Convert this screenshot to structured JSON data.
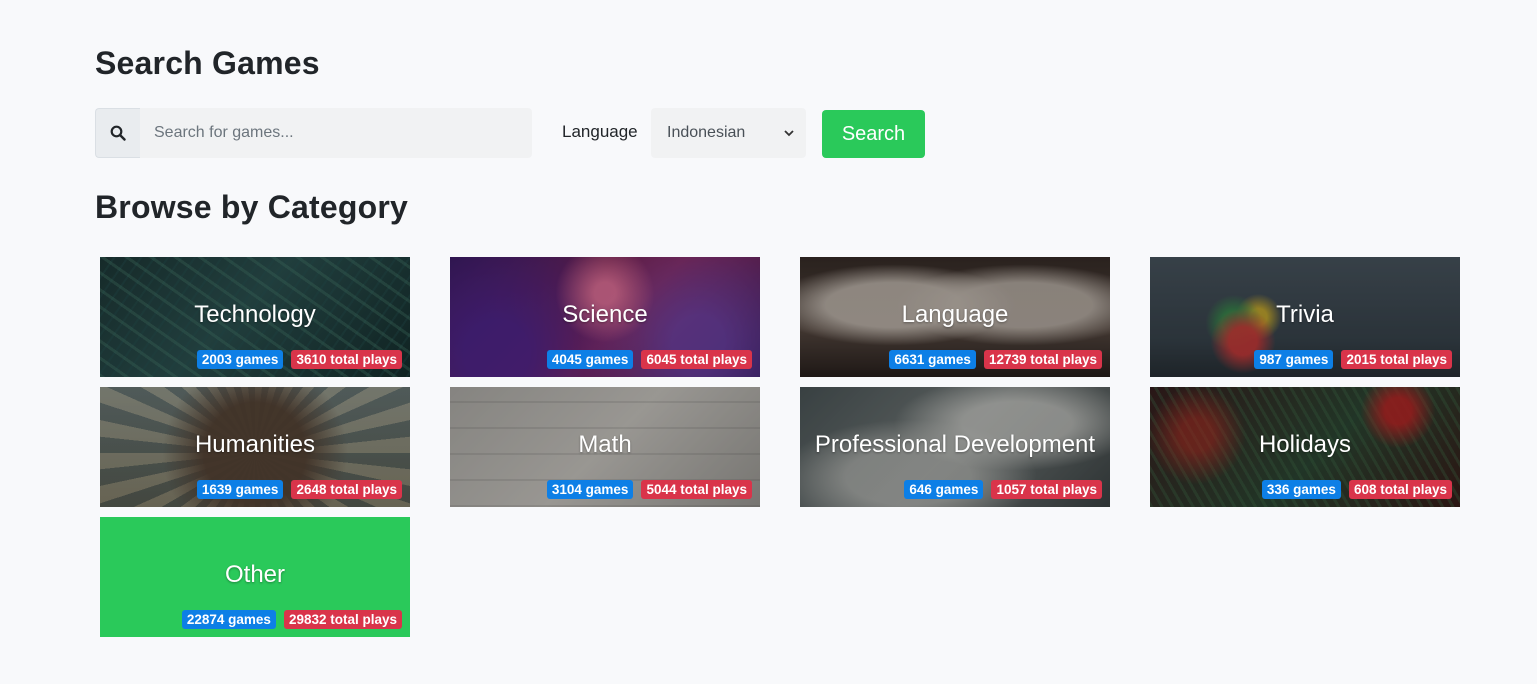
{
  "headings": {
    "search_games": "Search Games",
    "browse_by_category": "Browse by Category"
  },
  "search": {
    "placeholder": "Search for games...",
    "value": "",
    "icon": "search-icon"
  },
  "language": {
    "label": "Language",
    "selected": "Indonesian"
  },
  "search_button": {
    "label": "Search"
  },
  "colors": {
    "accent_green": "#2ac95a",
    "badge_blue": "#0d7fe6",
    "badge_red": "#d9344a"
  },
  "categories": [
    {
      "name": "Technology",
      "games": "2003 games",
      "plays": "3610 total plays"
    },
    {
      "name": "Science",
      "games": "4045 games",
      "plays": "6045 total plays"
    },
    {
      "name": "Language",
      "games": "6631 games",
      "plays": "12739 total plays"
    },
    {
      "name": "Trivia",
      "games": "987 games",
      "plays": "2015 total plays"
    },
    {
      "name": "Humanities",
      "games": "1639 games",
      "plays": "2648 total plays"
    },
    {
      "name": "Math",
      "games": "3104 games",
      "plays": "5044 total plays"
    },
    {
      "name": "Professional Development",
      "games": "646 games",
      "plays": "1057 total plays"
    },
    {
      "name": "Holidays",
      "games": "336 games",
      "plays": "608 total plays"
    },
    {
      "name": "Other",
      "games": "22874 games",
      "plays": "29832 total plays"
    }
  ]
}
